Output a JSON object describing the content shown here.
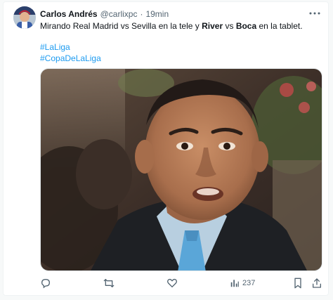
{
  "tweet": {
    "author_name": "Carlos Andrés",
    "handle": "@carlixpc",
    "separator": "·",
    "time": "19min",
    "text_part1": "Mirando Real Madrid vs Sevilla en la tele y ",
    "text_bold1": "River",
    "text_part2": " vs ",
    "text_bold2": "Boca",
    "text_part3": " en la tablet.",
    "hashtags": [
      "#LaLiga",
      "#CopaDeLaLiga"
    ]
  },
  "actions": {
    "views_count": "237"
  },
  "icons": {
    "more": "more-horizontal-icon",
    "reply": "reply-icon",
    "retweet": "retweet-icon",
    "like": "heart-icon",
    "views": "views-bar-chart-icon",
    "bookmark": "bookmark-icon",
    "share": "share-icon"
  },
  "colors": {
    "link": "#1d9bf0",
    "secondary_text": "#536471",
    "primary_text": "#0f1419"
  }
}
